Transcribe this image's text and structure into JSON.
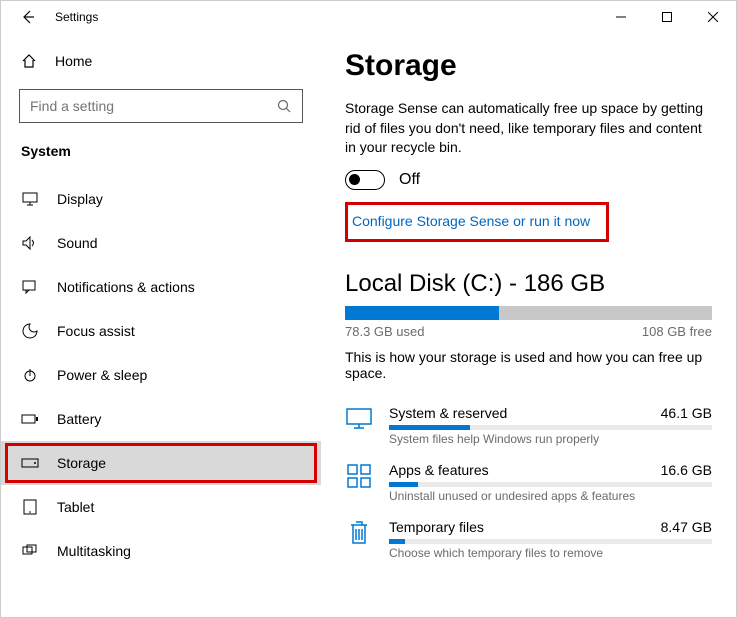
{
  "window": {
    "title": "Settings"
  },
  "sidebar": {
    "home": "Home",
    "search_placeholder": "Find a setting",
    "category": "System",
    "items": [
      {
        "label": "Display"
      },
      {
        "label": "Sound"
      },
      {
        "label": "Notifications & actions"
      },
      {
        "label": "Focus assist"
      },
      {
        "label": "Power & sleep"
      },
      {
        "label": "Battery"
      },
      {
        "label": "Storage"
      },
      {
        "label": "Tablet"
      },
      {
        "label": "Multitasking"
      }
    ]
  },
  "main": {
    "heading": "Storage",
    "description": "Storage Sense can automatically free up space by getting rid of files you don't need, like temporary files and content in your recycle bin.",
    "toggle_state": "Off",
    "configure_link": "Configure Storage Sense or run it now",
    "disk": {
      "title": "Local Disk (C:) - 186 GB",
      "used_label": "78.3 GB used",
      "free_label": "108 GB free",
      "used_pct": 42
    },
    "usage_desc": "This is how your storage is used and how you can free up space.",
    "categories": [
      {
        "name": "System & reserved",
        "size": "46.1 GB",
        "hint": "System files help Windows run properly",
        "pct": 25
      },
      {
        "name": "Apps & features",
        "size": "16.6 GB",
        "hint": "Uninstall unused or undesired apps & features",
        "pct": 9
      },
      {
        "name": "Temporary files",
        "size": "8.47 GB",
        "hint": "Choose which temporary files to remove",
        "pct": 5
      }
    ]
  }
}
